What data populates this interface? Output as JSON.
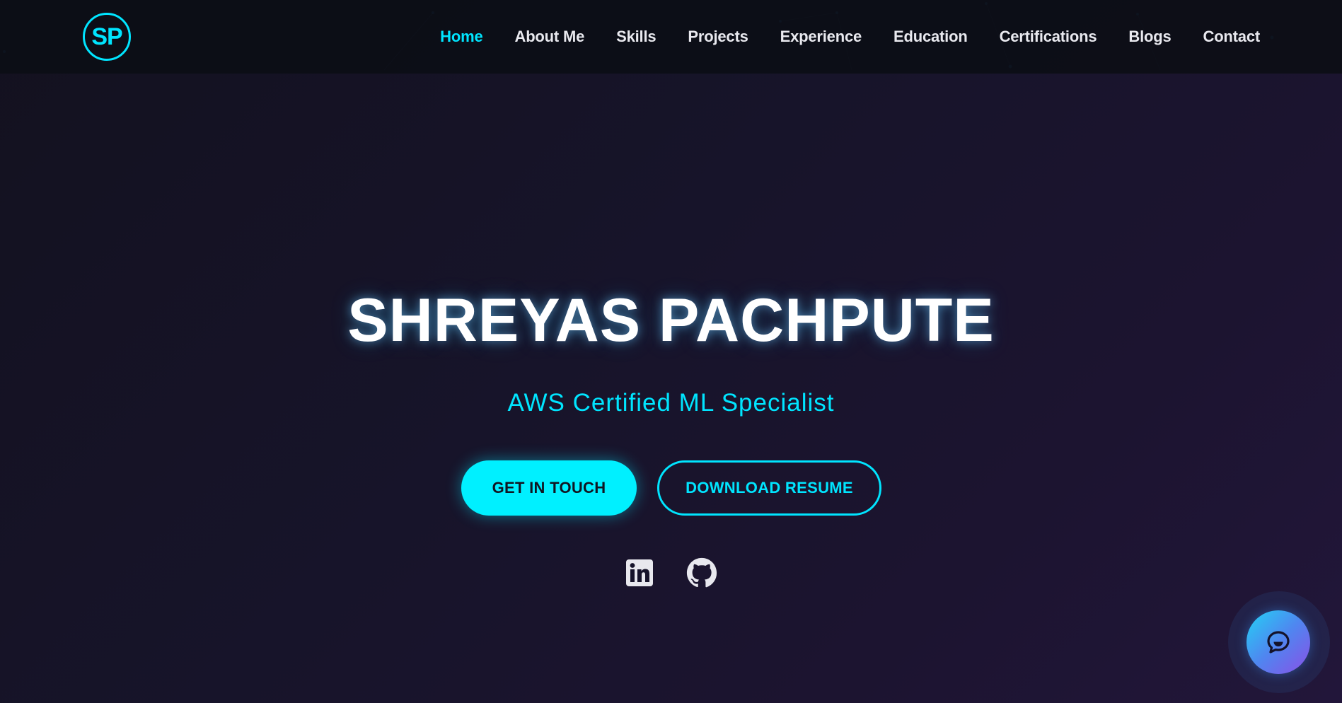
{
  "brand": {
    "logo_text": "SP",
    "accent_color": "#00e5ff"
  },
  "nav": {
    "items": [
      {
        "label": "Home",
        "active": true
      },
      {
        "label": "About Me",
        "active": false
      },
      {
        "label": "Skills",
        "active": false
      },
      {
        "label": "Projects",
        "active": false
      },
      {
        "label": "Experience",
        "active": false
      },
      {
        "label": "Education",
        "active": false
      },
      {
        "label": "Certifications",
        "active": false
      },
      {
        "label": "Blogs",
        "active": false
      },
      {
        "label": "Contact",
        "active": false
      }
    ]
  },
  "hero": {
    "name": "SHREYAS PACHPUTE",
    "subtitle": "AWS Certified ML Specialist",
    "primary_button": "GET IN TOUCH",
    "secondary_button": "DOWNLOAD RESUME"
  },
  "social": {
    "icons": [
      "linkedin-icon",
      "github-icon"
    ]
  },
  "chat": {
    "icon": "chat-bubble-icon"
  }
}
